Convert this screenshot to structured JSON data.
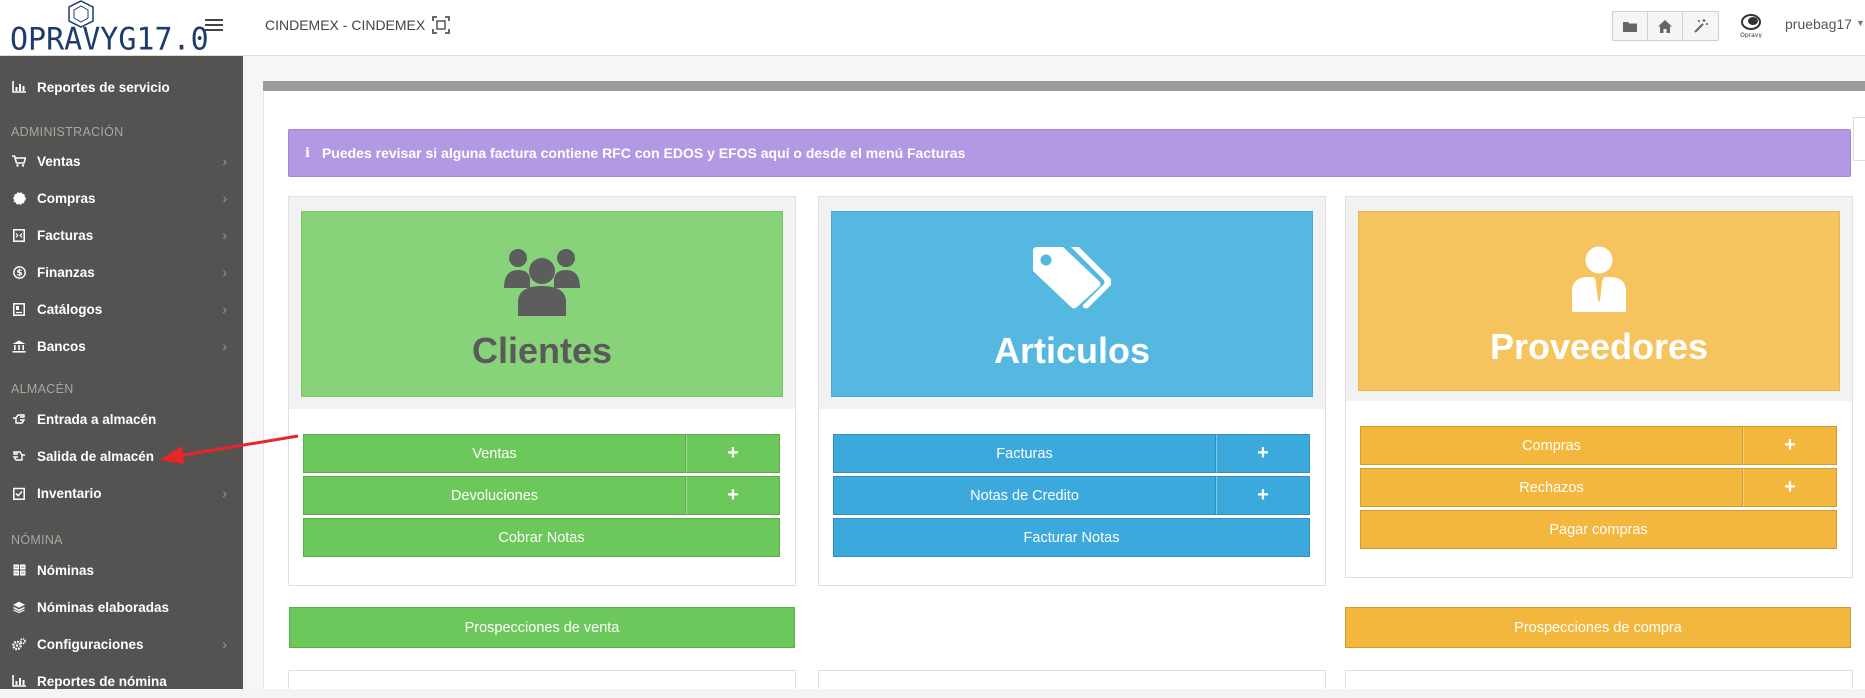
{
  "topbar": {
    "logo_text": "OPRAVYG17.0",
    "company": "CINDEMEX - CINDEMEX",
    "tools": [
      {
        "icon": "folder-icon"
      },
      {
        "icon": "home-icon"
      },
      {
        "icon": "magic-wand-icon"
      }
    ],
    "user_name": "pruebag17"
  },
  "sidebar": {
    "top_item": {
      "label": "Reportes de servicio",
      "icon": "bar-chart-icon"
    },
    "sections": [
      {
        "title": "ADMINISTRACIÓN",
        "items": [
          {
            "label": "Ventas",
            "icon": "cart-icon",
            "has_children": true
          },
          {
            "label": "Compras",
            "icon": "badge-icon",
            "has_children": true
          },
          {
            "label": "Facturas",
            "icon": "invoice-icon",
            "has_children": true
          },
          {
            "label": "Finanzas",
            "icon": "dollar-icon",
            "has_children": true
          },
          {
            "label": "Catálogos",
            "icon": "book-icon",
            "has_children": true
          },
          {
            "label": "Bancos",
            "icon": "bank-icon",
            "has_children": true
          }
        ]
      },
      {
        "title": "ALMACÉN",
        "items": [
          {
            "label": "Entrada a almacén",
            "icon": "hand-right-icon",
            "has_children": false
          },
          {
            "label": "Salida de almacén",
            "icon": "hand-left-icon",
            "has_children": false
          },
          {
            "label": "Inventario",
            "icon": "checklist-icon",
            "has_children": true
          }
        ]
      },
      {
        "title": "NÓMINA",
        "items": [
          {
            "label": "Nóminas",
            "icon": "grid-icon",
            "has_children": false
          },
          {
            "label": "Nóminas elaboradas",
            "icon": "layers-icon",
            "has_children": false
          },
          {
            "label": "Configuraciones",
            "icon": "gears-icon",
            "has_children": true
          },
          {
            "label": "Reportes de nómina",
            "icon": "bar-chart-icon",
            "has_children": false
          }
        ]
      }
    ]
  },
  "alert": {
    "icon": "info-icon",
    "text": "Puedes revisar si alguna factura contiene RFC con EDOS y EFOS aquí o desde el menú Facturas"
  },
  "cards": {
    "clientes": {
      "title": "Clientes",
      "icon": "users-icon",
      "color": "#88d27a",
      "actions": [
        "Ventas",
        "Devoluciones"
      ],
      "plus": "+",
      "full_action": "Cobrar Notas",
      "bottom_action": "Prospecciones de venta"
    },
    "articulos": {
      "title": "Articulos",
      "icon": "tags-icon",
      "color": "#55b8e0",
      "actions": [
        "Facturas",
        "Notas de Credito"
      ],
      "plus": "+",
      "full_action": "Facturar Notas"
    },
    "proveedores": {
      "title": "Proveedores",
      "icon": "user-tie-icon",
      "color": "#f5c45e",
      "actions": [
        "Compras",
        "Rechazos"
      ],
      "plus": "+",
      "full_action": "Pagar compras",
      "bottom_action": "Prospecciones de compra"
    }
  },
  "colors": {
    "sidebar": "#555351",
    "green_button": "#6cc85a",
    "blue_button": "#3ba9dc",
    "yellow_button": "#f4b73d",
    "alert": "#b399e3",
    "annotation_arrow": "#e8262a"
  }
}
